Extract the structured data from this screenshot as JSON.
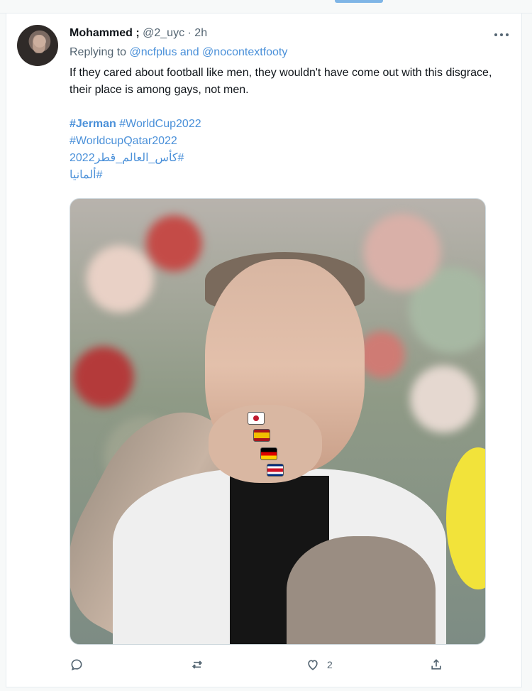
{
  "tweet": {
    "author_name": "Mohammed ;",
    "handle": "@2_uyc",
    "separator": "·",
    "time": "2h",
    "reply_prefix": "Replying to",
    "mention_1": "@ncfplus",
    "reply_and": "and",
    "mention_2": "@nocontextfooty",
    "text": "If they cared about football like men, they wouldn't have come out with this disgrace, their place is among gays, not men.",
    "hashtags": {
      "h1": "#Jerman",
      "h2": "#WorldCup2022",
      "h3": "#WorldcupQatar2022",
      "h4": "#كأس_العالم_قطر2022",
      "h5": "#ألمانيا"
    }
  },
  "actions": {
    "reply_icon": "speech-bubble-icon",
    "retweet_icon": "retweet-icon",
    "like_icon": "heart-icon",
    "like_count": "2",
    "share_icon": "share-icon"
  },
  "colors": {
    "link": "#4a90d9",
    "muted": "#536471",
    "text": "#0f1419"
  }
}
